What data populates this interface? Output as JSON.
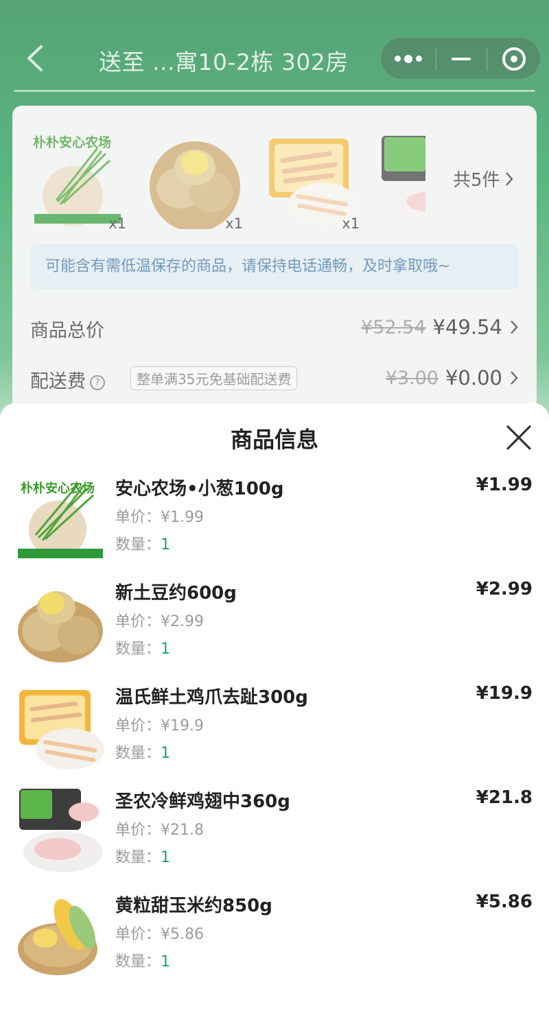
{
  "header": {
    "title": "送至 ...寓10-2栋 302房"
  },
  "order": {
    "thumbs": [
      {
        "icon": "scallion-image",
        "qty": "x1",
        "brand": "朴朴安心农场"
      },
      {
        "icon": "potato-image",
        "qty": "x1"
      },
      {
        "icon": "chicken-feet-image",
        "qty": "x1"
      },
      {
        "icon": "chicken-wings-image",
        "qty": ""
      }
    ],
    "count_label": "共5件",
    "notice": "可能含有需低温保存的商品，请保持电话通畅，及时拿取哦~",
    "goods_total": {
      "label": "商品总价",
      "original": "¥52.54",
      "current": "¥49.54"
    },
    "delivery": {
      "label": "配送费",
      "help": "?",
      "promo": "整单满35元免基础配送费",
      "original": "¥3.00",
      "current": "¥0.00"
    }
  },
  "sheet": {
    "title": "商品信息",
    "unit_prefix": "单价：",
    "qty_prefix": "数量：",
    "items": [
      {
        "name": "安心农场•小葱100g",
        "unit_price": "¥1.99",
        "qty": "1",
        "total": "¥1.99",
        "icon": "scallion-image",
        "brand": "朴朴安心农场"
      },
      {
        "name": "新土豆约600g",
        "unit_price": "¥2.99",
        "qty": "1",
        "total": "¥2.99",
        "icon": "potato-image"
      },
      {
        "name": "温氏鲜土鸡爪去趾300g",
        "unit_price": "¥19.9",
        "qty": "1",
        "total": "¥19.9",
        "icon": "chicken-feet-image"
      },
      {
        "name": "圣农冷鲜鸡翅中360g",
        "unit_price": "¥21.8",
        "qty": "1",
        "total": "¥21.8",
        "icon": "chicken-wings-image"
      },
      {
        "name": "黄粒甜玉米约850g",
        "unit_price": "¥5.86",
        "qty": "1",
        "total": "¥5.86",
        "icon": "corn-image"
      }
    ]
  },
  "colors": {
    "brand_green": "#1aa659",
    "notice_text": "#3e73a8"
  }
}
